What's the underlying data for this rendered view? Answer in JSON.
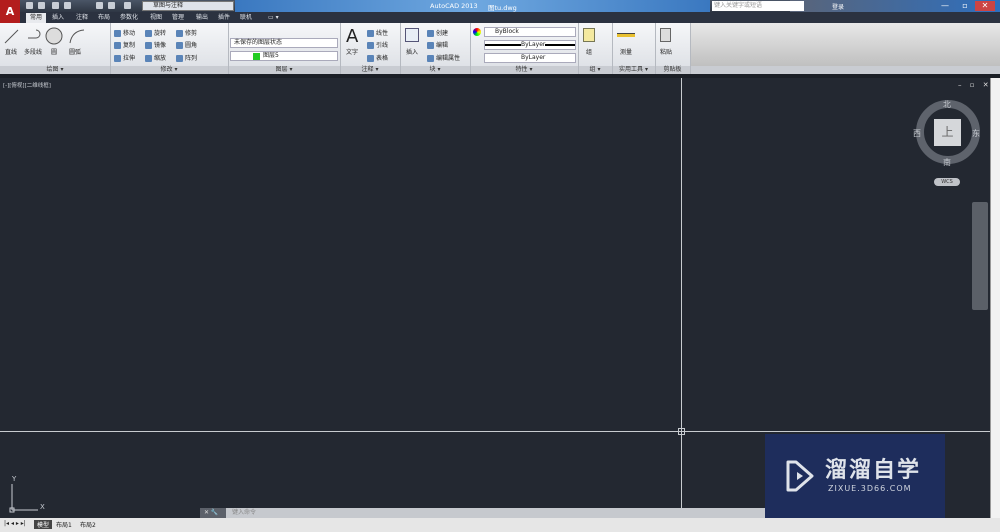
{
  "titlebar": {
    "app_title": "AutoCAD 2013",
    "file_name": "图tu.dwg",
    "workspace": "草图与注释",
    "search_placeholder": "键入关键字或短语",
    "login": "登录",
    "min": "—",
    "max": "▫",
    "close": "✕",
    "logo": "A"
  },
  "tabs": [
    "常用",
    "插入",
    "注释",
    "布局",
    "参数化",
    "视图",
    "管理",
    "输出",
    "插件",
    "联机",
    "▭ ▾"
  ],
  "ribbon": {
    "draw": {
      "label": "绘图 ▾",
      "items": [
        "直线",
        "多段线",
        "圆",
        "圆弧"
      ]
    },
    "modify": {
      "label": "修改 ▾",
      "items": [
        "移动",
        "旋转",
        "修剪",
        "复制",
        "镜像",
        "圆角",
        "拉伸",
        "缩放",
        "阵列"
      ]
    },
    "layers": {
      "label": "图层 ▾",
      "state": "未保存的图层状态",
      "layer": "图层5",
      "layer_color": "#22cc22"
    },
    "annotation": {
      "label": "注释 ▾",
      "text": "文字",
      "items": [
        "线性",
        "引线",
        "表格"
      ]
    },
    "block": {
      "label": "块 ▾",
      "insert": "插入",
      "items": [
        "创建",
        "编辑",
        "编辑属性"
      ]
    },
    "properties": {
      "label": "特性 ▾",
      "color": "ByBlock",
      "lineweight": "ByLayer",
      "linetype": "ByLayer"
    },
    "groups": {
      "label": "组 ▾",
      "group": "组"
    },
    "utilities": {
      "label": "实用工具 ▾",
      "measure": "测量"
    },
    "clipboard": {
      "label": "剪贴板",
      "paste": "粘贴"
    }
  },
  "viewport": {
    "label": "[-][俯视][二维线框]",
    "controls": "– ▫ ✕"
  },
  "viewcube": {
    "north": "北",
    "south": "南",
    "east": "东",
    "west": "西",
    "face": "上",
    "wcs": "WCS"
  },
  "ucs": {
    "x": "X",
    "y": "Y"
  },
  "command": {
    "placeholder": "键入命令",
    "left": "✕ 🔧"
  },
  "layout_tabs": [
    "模型",
    "布局1",
    "布局2"
  ],
  "nav_arrows": "|◂ ◂ ▸ ▸|",
  "watermark": {
    "title": "溜溜自学",
    "url": "ZIXUE.3D66.COM"
  }
}
